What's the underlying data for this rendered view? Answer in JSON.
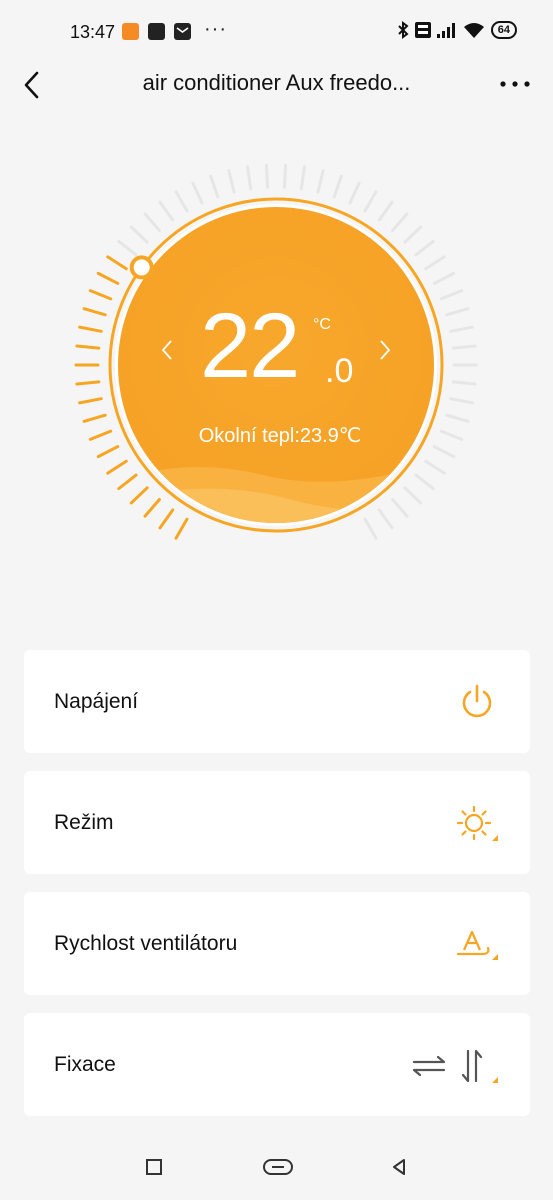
{
  "status_bar": {
    "time": "13:47",
    "battery": "64",
    "more_glyph": "···"
  },
  "header": {
    "title": "air conditioner Aux freedo..."
  },
  "thermostat": {
    "set_temp_int": "22",
    "set_temp_dec": ".0",
    "unit": "°C",
    "ambient_text": "Okolní tepl:23.9℃",
    "dial_fill_fraction": 0.32
  },
  "controls": [
    {
      "label": "Napájení",
      "icon": "power-icon"
    },
    {
      "label": "Režim",
      "icon": "sun-icon"
    },
    {
      "label": "Rychlost ventilátoru",
      "icon": "fan-auto-icon"
    },
    {
      "label": "Fixace",
      "icon": "swing-icon"
    }
  ],
  "colors": {
    "accent": "#f6a623",
    "accent_light": "#fbc15e",
    "inactive_tick": "#e6e6e6",
    "card_bg": "#ffffff",
    "page_bg": "#f5f5f5"
  }
}
